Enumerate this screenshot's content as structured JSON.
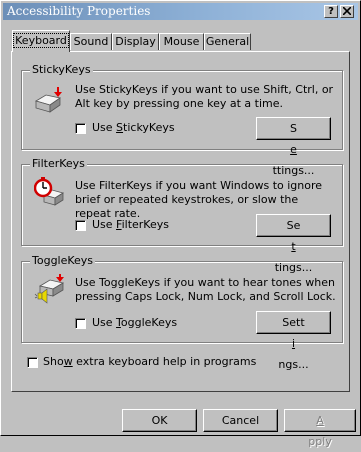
{
  "window": {
    "title": "Accessibility Properties",
    "help_btn": "?",
    "close_btn": "x"
  },
  "tabs": [
    {
      "label": "Keyboard",
      "active": true
    },
    {
      "label": "Sound",
      "active": false
    },
    {
      "label": "Display",
      "active": false
    },
    {
      "label": "Mouse",
      "active": false
    },
    {
      "label": "General",
      "active": false
    }
  ],
  "groups": {
    "sticky": {
      "title": "StickyKeys",
      "description": "Use StickyKeys if you want to use Shift, Ctrl, or Alt key by pressing one key at a time.",
      "checkbox_pre": "Use ",
      "checkbox_acc": "S",
      "checkbox_post": "tickyKeys",
      "checked": false,
      "settings_pre": "S",
      "settings_acc": "e",
      "settings_post": "ttings...",
      "icon": "sticky-keys-icon"
    },
    "filter": {
      "title": "FilterKeys",
      "description": "Use FilterKeys if you want Windows to ignore brief or repeated keystrokes, or slow the repeat rate.",
      "checkbox_pre": "Use ",
      "checkbox_acc": "F",
      "checkbox_post": "ilterKeys",
      "checked": false,
      "settings_pre": "Se",
      "settings_acc": "t",
      "settings_post": "tings...",
      "icon": "filter-keys-stopwatch-icon"
    },
    "toggle": {
      "title": "ToggleKeys",
      "description": "Use ToggleKeys if you want to hear tones when pressing Caps Lock, Num Lock, and Scroll Lock.",
      "checkbox_pre": "Use ",
      "checkbox_acc": "T",
      "checkbox_post": "oggleKeys",
      "checked": false,
      "settings_pre": "Sett",
      "settings_acc": "i",
      "settings_post": "ngs...",
      "icon": "toggle-keys-speaker-icon"
    }
  },
  "extra_help": {
    "pre": "Sho",
    "acc": "w",
    "post": " extra keyboard help in programs",
    "checked": false
  },
  "buttons": {
    "ok": "OK",
    "cancel": "Cancel",
    "apply_acc": "A",
    "apply_post": "pply",
    "apply_disabled": true
  }
}
